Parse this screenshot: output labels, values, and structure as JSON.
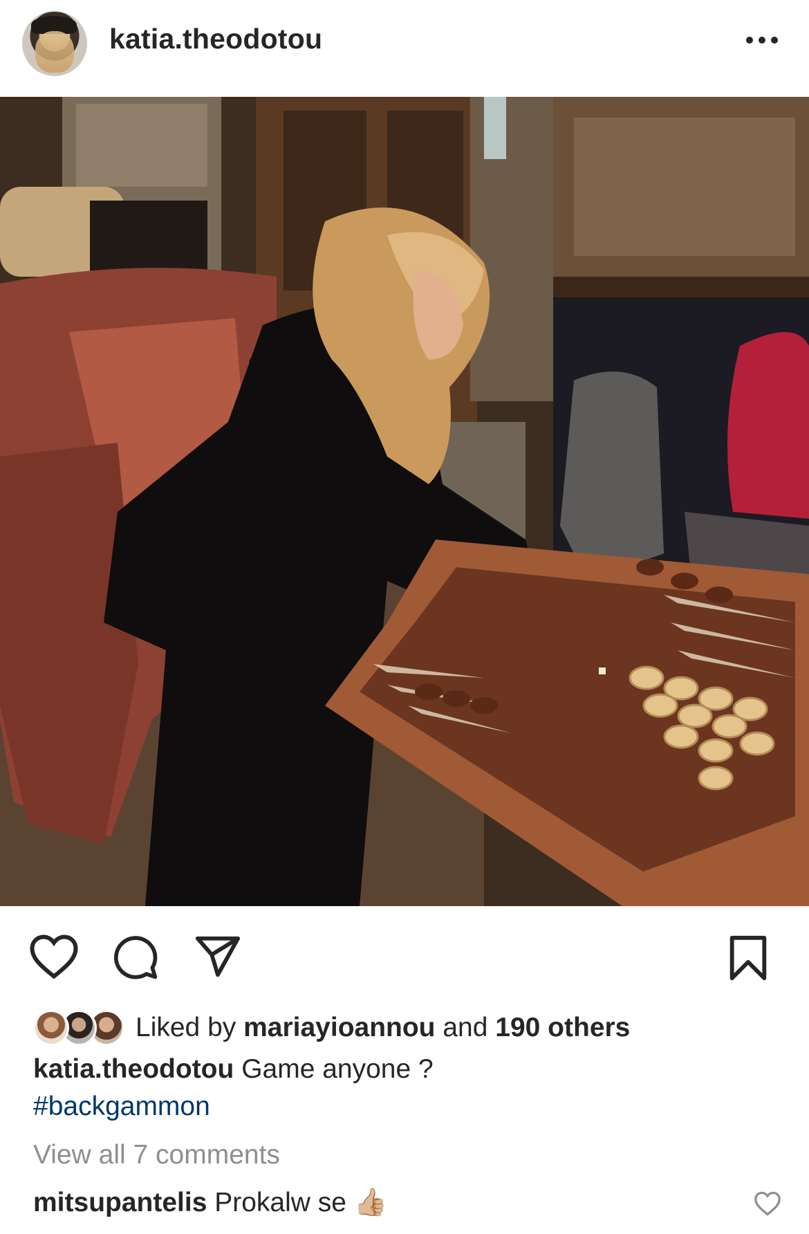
{
  "post": {
    "username": "katia.theodotou",
    "more_icon": "more-horizontal-icon",
    "image_alt": "Woman playing backgammon in a lounge"
  },
  "actions": {
    "like_icon": "heart-icon",
    "comment_icon": "comment-icon",
    "share_icon": "send-icon",
    "save_icon": "bookmark-icon"
  },
  "likes": {
    "prefix": "Liked by",
    "user": "mariayioannou",
    "middle": "and",
    "others": "190 others"
  },
  "caption": {
    "username": "katia.theodotou",
    "text": "Game anyone ?",
    "hashtag": "#backgammon"
  },
  "comments": {
    "view_all": "View all 7 comments",
    "first": {
      "username": "mitsupantelis",
      "text": "Prokalw se",
      "emoji": "👍🏼"
    }
  },
  "colors": {
    "text": "#262626",
    "hashtag": "#00376b",
    "muted": "#8e8e8e"
  }
}
